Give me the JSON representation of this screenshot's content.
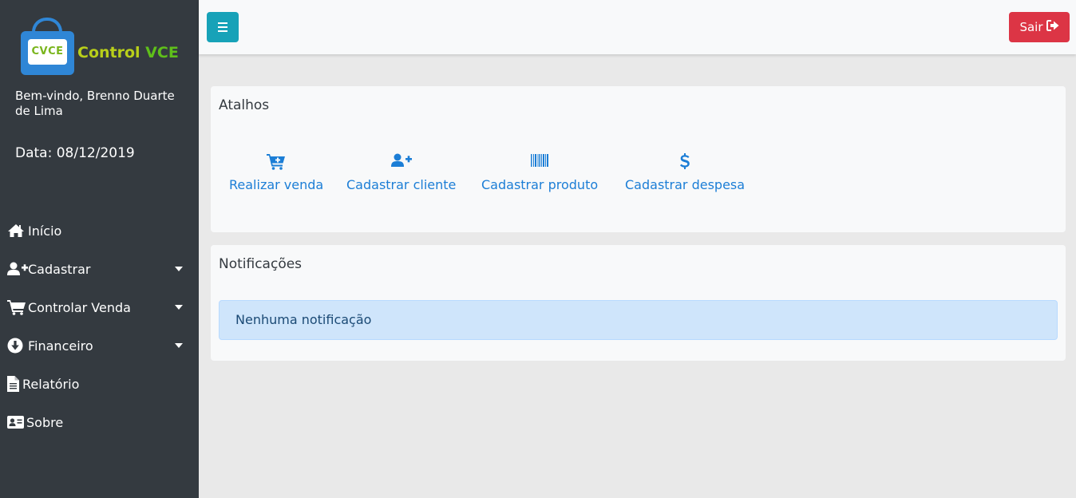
{
  "brand": {
    "logo_badge": "CVCE",
    "name_part1": "Control ",
    "name_part2": "VCE"
  },
  "user": {
    "welcome": "Bem-vindo, Brenno Duarte de Lima",
    "date": "Data: 08/12/2019"
  },
  "sidebar": {
    "items": [
      {
        "label": "Início",
        "icon": "home-icon"
      },
      {
        "label": "Cadastrar",
        "icon": "user-plus-icon"
      },
      {
        "label": "Controlar Venda",
        "icon": "cart-icon"
      },
      {
        "label": "Financeiro",
        "icon": "arrow-circle-down-icon"
      },
      {
        "label": "Relatório",
        "icon": "file-text-icon"
      },
      {
        "label": "Sobre",
        "icon": "id-card-icon"
      }
    ]
  },
  "topbar": {
    "logout_label": "Sair"
  },
  "shortcuts": {
    "title": "Atalhos",
    "items": [
      {
        "label": "Realizar venda",
        "icon": "cart-plus-icon"
      },
      {
        "label": "Cadastrar cliente",
        "icon": "user-plus-icon"
      },
      {
        "label": "Cadastrar produto",
        "icon": "barcode-icon"
      },
      {
        "label": "Cadastrar despesa",
        "icon": "dollar-icon"
      }
    ]
  },
  "notifications": {
    "title": "Notificações",
    "empty_message": "Nenhuma notificação"
  },
  "colors": {
    "sidebar": "#343a40",
    "primary_link": "#1c7ed6",
    "toggle": "#17a2b8",
    "danger": "#dc3545",
    "alert_bg": "#cfe5fb"
  }
}
